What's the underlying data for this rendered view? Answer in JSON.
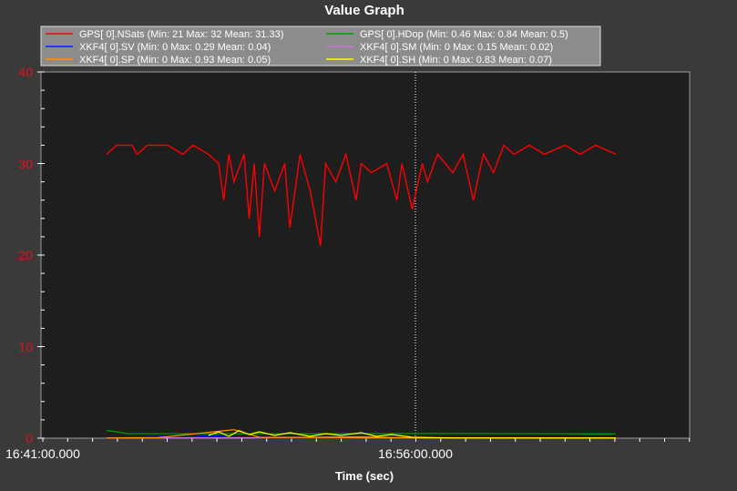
{
  "chart_data": {
    "type": "line",
    "title": "Value Graph",
    "xlabel": "Time (sec)",
    "ylabel": "",
    "ylim": [
      0,
      40
    ],
    "yticks": [
      "0",
      "10",
      "20",
      "30",
      "40"
    ],
    "x_ticks": [
      "16:41:00.000",
      "16:56:00.000"
    ],
    "x_range": [
      "16:41:00.000",
      "17:00:30.000"
    ],
    "data_x_range": [
      "16:43:30.000",
      "17:02:15.000"
    ],
    "grid": "vertical dotted line at 16:56:00.000",
    "legend_position": "top",
    "series": [
      {
        "legend_label": "GPS[ 0].NSats  (Min: 21 Max: 32 Mean: 31.33)",
        "color": "#ff0000",
        "min": 21,
        "max": 32,
        "mean": 31.33,
        "points": [
          [
            0,
            31
          ],
          [
            0.02,
            32
          ],
          [
            0.05,
            32
          ],
          [
            0.06,
            31
          ],
          [
            0.08,
            32
          ],
          [
            0.12,
            32
          ],
          [
            0.15,
            31
          ],
          [
            0.17,
            32
          ],
          [
            0.2,
            31
          ],
          [
            0.22,
            30
          ],
          [
            0.23,
            26
          ],
          [
            0.24,
            31
          ],
          [
            0.25,
            28
          ],
          [
            0.27,
            31
          ],
          [
            0.28,
            24
          ],
          [
            0.29,
            30
          ],
          [
            0.3,
            22
          ],
          [
            0.31,
            30
          ],
          [
            0.33,
            27
          ],
          [
            0.35,
            30
          ],
          [
            0.36,
            23
          ],
          [
            0.38,
            31
          ],
          [
            0.4,
            27
          ],
          [
            0.42,
            21
          ],
          [
            0.43,
            30
          ],
          [
            0.45,
            28
          ],
          [
            0.47,
            31
          ],
          [
            0.49,
            26
          ],
          [
            0.5,
            30
          ],
          [
            0.52,
            29
          ],
          [
            0.55,
            30
          ],
          [
            0.57,
            26
          ],
          [
            0.58,
            30
          ],
          [
            0.6,
            25
          ],
          [
            0.62,
            30
          ],
          [
            0.63,
            28
          ],
          [
            0.65,
            31
          ],
          [
            0.68,
            29
          ],
          [
            0.7,
            31
          ],
          [
            0.72,
            26
          ],
          [
            0.74,
            31
          ],
          [
            0.76,
            29
          ],
          [
            0.78,
            32
          ],
          [
            0.8,
            31
          ],
          [
            0.83,
            32
          ],
          [
            0.86,
            31
          ],
          [
            0.9,
            32
          ],
          [
            0.93,
            31
          ],
          [
            0.96,
            32
          ],
          [
            1,
            31
          ]
        ]
      },
      {
        "legend_label": "GPS[ 0].HDop  (Min: 0.46 Max: 0.84 Mean: 0.5)",
        "color": "#00a000",
        "min": 0.46,
        "max": 0.84,
        "mean": 0.5,
        "points": [
          [
            0,
            0.84
          ],
          [
            0.02,
            0.7
          ],
          [
            0.04,
            0.5
          ],
          [
            0.3,
            0.48
          ],
          [
            0.5,
            0.5
          ],
          [
            0.7,
            0.52
          ],
          [
            0.9,
            0.48
          ],
          [
            1,
            0.46
          ]
        ]
      },
      {
        "legend_label": "XKF4[ 0].SV  (Min: 0 Max: 0.29 Mean: 0.04)",
        "color": "#0020ff",
        "min": 0,
        "max": 0.29,
        "mean": 0.04,
        "points": [
          [
            0,
            0.05
          ],
          [
            0.05,
            0.1
          ],
          [
            0.1,
            0.2
          ],
          [
            0.15,
            0.05
          ],
          [
            0.2,
            0.29
          ],
          [
            0.3,
            0.02
          ],
          [
            0.5,
            0.03
          ],
          [
            0.7,
            0.02
          ],
          [
            1,
            0.01
          ]
        ]
      },
      {
        "legend_label": "XKF4[ 0].SM  (Min: 0 Max: 0.15 Mean: 0.02)",
        "color": "#d070e0",
        "min": 0,
        "max": 0.15,
        "mean": 0.02,
        "points": [
          [
            0,
            0.02
          ],
          [
            0.3,
            0.05
          ],
          [
            0.5,
            0.15
          ],
          [
            0.6,
            0.03
          ],
          [
            0.8,
            0.02
          ],
          [
            1,
            0.01
          ]
        ]
      },
      {
        "legend_label": "XKF4[ 0].SP  (Min: 0 Max: 0.93 Mean: 0.05)",
        "color": "#ff9000",
        "min": 0,
        "max": 0.93,
        "mean": 0.05,
        "points": [
          [
            0,
            0.02
          ],
          [
            0.1,
            0.05
          ],
          [
            0.25,
            0.93
          ],
          [
            0.3,
            0.1
          ],
          [
            0.5,
            0.05
          ],
          [
            0.7,
            0.03
          ],
          [
            1,
            0.02
          ]
        ]
      },
      {
        "legend_label": "XKF4[ 0].SH  (Min: 0 Max: 0.83 Mean: 0.07)",
        "color": "#ffff00",
        "min": 0,
        "max": 0.83,
        "mean": 0.07,
        "points": [
          [
            0.2,
            0.3
          ],
          [
            0.22,
            0.7
          ],
          [
            0.24,
            0.2
          ],
          [
            0.26,
            0.83
          ],
          [
            0.28,
            0.4
          ],
          [
            0.3,
            0.7
          ],
          [
            0.33,
            0.3
          ],
          [
            0.36,
            0.6
          ],
          [
            0.4,
            0.2
          ],
          [
            0.43,
            0.5
          ],
          [
            0.46,
            0.3
          ],
          [
            0.5,
            0.6
          ],
          [
            0.53,
            0.2
          ],
          [
            0.56,
            0.4
          ],
          [
            0.6,
            0.1
          ],
          [
            0.65,
            0.05
          ],
          [
            0.7,
            0.02
          ],
          [
            1,
            0.01
          ]
        ]
      }
    ]
  },
  "colors": {
    "background": "#3a3a3a",
    "plot_background": "#1e1e1e",
    "y_tick": "#e0101a",
    "legend_background": "#8c8c8c"
  }
}
